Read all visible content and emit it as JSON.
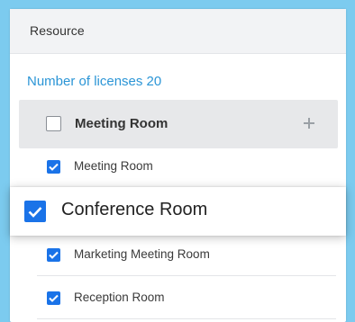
{
  "panel": {
    "title": "Resource",
    "license_text": "Number of licenses 20"
  },
  "group": {
    "label": "Meeting Room",
    "checked": false,
    "add_icon": "plus-icon"
  },
  "items": [
    {
      "label": "Meeting Room",
      "checked": true
    },
    {
      "label": "Conference Room",
      "checked": true,
      "highlighted": true
    },
    {
      "label": "Marketing Meeting Room",
      "checked": true
    },
    {
      "label": "Reception Room",
      "checked": true
    }
  ],
  "colors": {
    "accent": "#1a73e8",
    "link": "#2b95d6",
    "background": "#7ccbef"
  }
}
